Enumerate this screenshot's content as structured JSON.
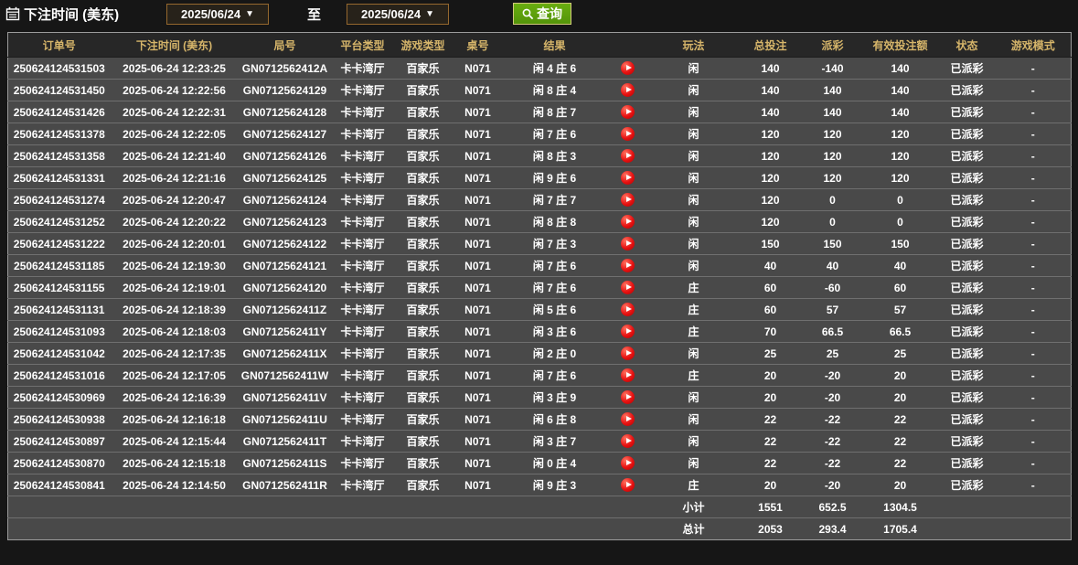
{
  "filters": {
    "title": "下注时间 (美东)",
    "date_from": "2025/06/24",
    "date_to": "2025/06/24",
    "to_label": "至",
    "caret": "▼",
    "search_label": "查询"
  },
  "table": {
    "headers": [
      "订单号",
      "下注时间 (美东)",
      "局号",
      "平台类型",
      "游戏类型",
      "桌号",
      "结果",
      "",
      "玩法",
      "总投注",
      "派彩",
      "有效投注额",
      "状态",
      "游戏模式"
    ],
    "rows": [
      {
        "order": "250624124531503",
        "time": "2025-06-24 12:23:25",
        "round": "GN0712562412A",
        "platform": "卡卡湾厅",
        "game": "百家乐",
        "table_no": "N071",
        "result": "闲 4 庄 6",
        "bet_type": "闲",
        "total_bet": "140",
        "payout": "-140",
        "valid_bet": "140",
        "status": "已派彩",
        "mode": "-"
      },
      {
        "order": "250624124531450",
        "time": "2025-06-24 12:22:56",
        "round": "GN07125624129",
        "platform": "卡卡湾厅",
        "game": "百家乐",
        "table_no": "N071",
        "result": "闲 8 庄 4",
        "bet_type": "闲",
        "total_bet": "140",
        "payout": "140",
        "valid_bet": "140",
        "status": "已派彩",
        "mode": "-"
      },
      {
        "order": "250624124531426",
        "time": "2025-06-24 12:22:31",
        "round": "GN07125624128",
        "platform": "卡卡湾厅",
        "game": "百家乐",
        "table_no": "N071",
        "result": "闲 8 庄 7",
        "bet_type": "闲",
        "total_bet": "140",
        "payout": "140",
        "valid_bet": "140",
        "status": "已派彩",
        "mode": "-"
      },
      {
        "order": "250624124531378",
        "time": "2025-06-24 12:22:05",
        "round": "GN07125624127",
        "platform": "卡卡湾厅",
        "game": "百家乐",
        "table_no": "N071",
        "result": "闲 7 庄 6",
        "bet_type": "闲",
        "total_bet": "120",
        "payout": "120",
        "valid_bet": "120",
        "status": "已派彩",
        "mode": "-"
      },
      {
        "order": "250624124531358",
        "time": "2025-06-24 12:21:40",
        "round": "GN07125624126",
        "platform": "卡卡湾厅",
        "game": "百家乐",
        "table_no": "N071",
        "result": "闲 8 庄 3",
        "bet_type": "闲",
        "total_bet": "120",
        "payout": "120",
        "valid_bet": "120",
        "status": "已派彩",
        "mode": "-"
      },
      {
        "order": "250624124531331",
        "time": "2025-06-24 12:21:16",
        "round": "GN07125624125",
        "platform": "卡卡湾厅",
        "game": "百家乐",
        "table_no": "N071",
        "result": "闲 9 庄 6",
        "bet_type": "闲",
        "total_bet": "120",
        "payout": "120",
        "valid_bet": "120",
        "status": "已派彩",
        "mode": "-"
      },
      {
        "order": "250624124531274",
        "time": "2025-06-24 12:20:47",
        "round": "GN07125624124",
        "platform": "卡卡湾厅",
        "game": "百家乐",
        "table_no": "N071",
        "result": "闲 7 庄 7",
        "bet_type": "闲",
        "total_bet": "120",
        "payout": "0",
        "valid_bet": "0",
        "status": "已派彩",
        "mode": "-"
      },
      {
        "order": "250624124531252",
        "time": "2025-06-24 12:20:22",
        "round": "GN07125624123",
        "platform": "卡卡湾厅",
        "game": "百家乐",
        "table_no": "N071",
        "result": "闲 8 庄 8",
        "bet_type": "闲",
        "total_bet": "120",
        "payout": "0",
        "valid_bet": "0",
        "status": "已派彩",
        "mode": "-"
      },
      {
        "order": "250624124531222",
        "time": "2025-06-24 12:20:01",
        "round": "GN07125624122",
        "platform": "卡卡湾厅",
        "game": "百家乐",
        "table_no": "N071",
        "result": "闲 7 庄 3",
        "bet_type": "闲",
        "total_bet": "150",
        "payout": "150",
        "valid_bet": "150",
        "status": "已派彩",
        "mode": "-"
      },
      {
        "order": "250624124531185",
        "time": "2025-06-24 12:19:30",
        "round": "GN07125624121",
        "platform": "卡卡湾厅",
        "game": "百家乐",
        "table_no": "N071",
        "result": "闲 7 庄 6",
        "bet_type": "闲",
        "total_bet": "40",
        "payout": "40",
        "valid_bet": "40",
        "status": "已派彩",
        "mode": "-"
      },
      {
        "order": "250624124531155",
        "time": "2025-06-24 12:19:01",
        "round": "GN07125624120",
        "platform": "卡卡湾厅",
        "game": "百家乐",
        "table_no": "N071",
        "result": "闲 7 庄 6",
        "bet_type": "庄",
        "total_bet": "60",
        "payout": "-60",
        "valid_bet": "60",
        "status": "已派彩",
        "mode": "-"
      },
      {
        "order": "250624124531131",
        "time": "2025-06-24 12:18:39",
        "round": "GN0712562411Z",
        "platform": "卡卡湾厅",
        "game": "百家乐",
        "table_no": "N071",
        "result": "闲 5 庄 6",
        "bet_type": "庄",
        "total_bet": "60",
        "payout": "57",
        "valid_bet": "57",
        "status": "已派彩",
        "mode": "-"
      },
      {
        "order": "250624124531093",
        "time": "2025-06-24 12:18:03",
        "round": "GN0712562411Y",
        "platform": "卡卡湾厅",
        "game": "百家乐",
        "table_no": "N071",
        "result": "闲 3 庄 6",
        "bet_type": "庄",
        "total_bet": "70",
        "payout": "66.5",
        "valid_bet": "66.5",
        "status": "已派彩",
        "mode": "-"
      },
      {
        "order": "250624124531042",
        "time": "2025-06-24 12:17:35",
        "round": "GN0712562411X",
        "platform": "卡卡湾厅",
        "game": "百家乐",
        "table_no": "N071",
        "result": "闲 2 庄 0",
        "bet_type": "闲",
        "total_bet": "25",
        "payout": "25",
        "valid_bet": "25",
        "status": "已派彩",
        "mode": "-"
      },
      {
        "order": "250624124531016",
        "time": "2025-06-24 12:17:05",
        "round": "GN0712562411W",
        "platform": "卡卡湾厅",
        "game": "百家乐",
        "table_no": "N071",
        "result": "闲 7 庄 6",
        "bet_type": "庄",
        "total_bet": "20",
        "payout": "-20",
        "valid_bet": "20",
        "status": "已派彩",
        "mode": "-"
      },
      {
        "order": "250624124530969",
        "time": "2025-06-24 12:16:39",
        "round": "GN0712562411V",
        "platform": "卡卡湾厅",
        "game": "百家乐",
        "table_no": "N071",
        "result": "闲 3 庄 9",
        "bet_type": "闲",
        "total_bet": "20",
        "payout": "-20",
        "valid_bet": "20",
        "status": "已派彩",
        "mode": "-"
      },
      {
        "order": "250624124530938",
        "time": "2025-06-24 12:16:18",
        "round": "GN0712562411U",
        "platform": "卡卡湾厅",
        "game": "百家乐",
        "table_no": "N071",
        "result": "闲 6 庄 8",
        "bet_type": "闲",
        "total_bet": "22",
        "payout": "-22",
        "valid_bet": "22",
        "status": "已派彩",
        "mode": "-"
      },
      {
        "order": "250624124530897",
        "time": "2025-06-24 12:15:44",
        "round": "GN0712562411T",
        "platform": "卡卡湾厅",
        "game": "百家乐",
        "table_no": "N071",
        "result": "闲 3 庄 7",
        "bet_type": "闲",
        "total_bet": "22",
        "payout": "-22",
        "valid_bet": "22",
        "status": "已派彩",
        "mode": "-"
      },
      {
        "order": "250624124530870",
        "time": "2025-06-24 12:15:18",
        "round": "GN0712562411S",
        "platform": "卡卡湾厅",
        "game": "百家乐",
        "table_no": "N071",
        "result": "闲 0 庄 4",
        "bet_type": "闲",
        "total_bet": "22",
        "payout": "-22",
        "valid_bet": "22",
        "status": "已派彩",
        "mode": "-"
      },
      {
        "order": "250624124530841",
        "time": "2025-06-24 12:14:50",
        "round": "GN0712562411R",
        "platform": "卡卡湾厅",
        "game": "百家乐",
        "table_no": "N071",
        "result": "闲 9 庄 3",
        "bet_type": "庄",
        "total_bet": "20",
        "payout": "-20",
        "valid_bet": "20",
        "status": "已派彩",
        "mode": "-"
      }
    ],
    "subtotal": {
      "label": "小计",
      "total_bet": "1551",
      "payout": "652.5",
      "valid_bet": "1304.5"
    },
    "total": {
      "label": "总计",
      "total_bet": "2053",
      "payout": "293.4",
      "valid_bet": "1705.4"
    }
  },
  "colors": {
    "header_text": "#d6b56a",
    "payout_positive": "#c2413a",
    "payout_negative": "#3ed43e",
    "status_paid": "#2ed32e",
    "footer_text": "#e2e22a",
    "search_button_green": "#5ea30d",
    "row_background": "#494949",
    "play_icon_red": "#e71111"
  }
}
